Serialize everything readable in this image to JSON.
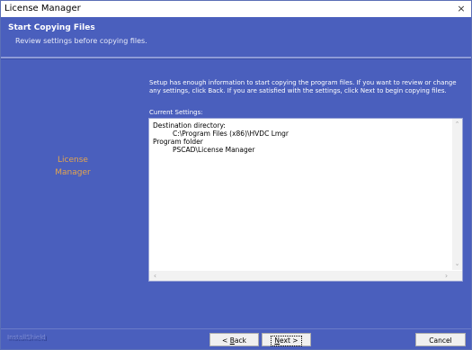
{
  "window": {
    "title": "License Manager",
    "close_glyph": "×"
  },
  "header": {
    "title": "Start Copying Files",
    "subtitle": "Review settings before copying files."
  },
  "sidebar": {
    "brand_line1": "License",
    "brand_line2": "Manager"
  },
  "main": {
    "intro": "Setup has enough information to start copying the program files.  If you want to review or change any settings, click Back.  If you are satisfied with the settings, click Next to begin copying files.",
    "current_settings_label": "Current Settings:",
    "settings": {
      "line1": "Destination directory:",
      "line2": "C:\\Program Files (x86)\\HVDC Lmgr",
      "line3": "Program folder",
      "line4": "PSCAD\\License Manager"
    }
  },
  "footer": {
    "brand": "InstallShield",
    "back_prefix": "< ",
    "back_key": "B",
    "back_rest": "ack",
    "next_key": "N",
    "next_rest": "ext >",
    "cancel": "Cancel"
  },
  "colors": {
    "background": "#4a5fbd",
    "brand_accent": "#e3a44f"
  },
  "icons": {
    "close": "close-icon",
    "scroll_up": "chevron-up-icon",
    "scroll_down": "chevron-down-icon",
    "scroll_left": "chevron-left-icon",
    "scroll_right": "chevron-right-icon"
  }
}
